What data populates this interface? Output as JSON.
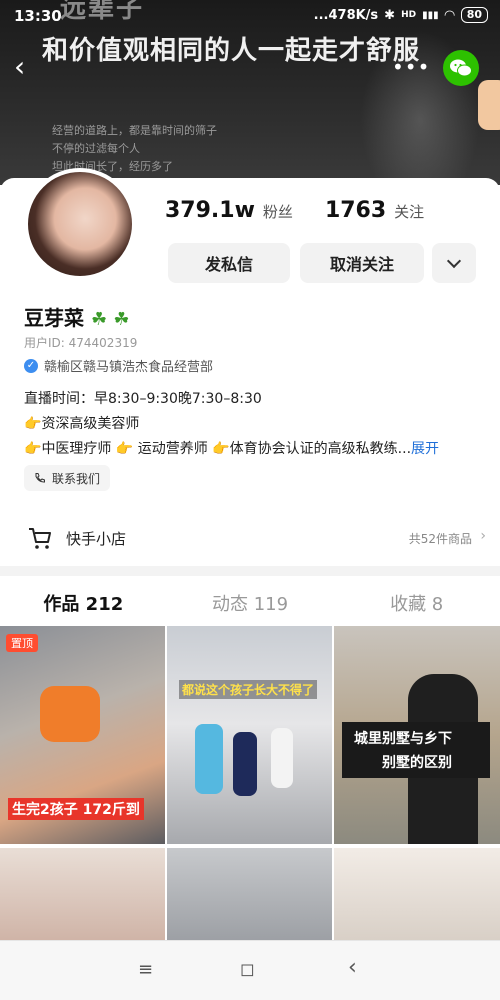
{
  "status_bar": {
    "time": "13:30",
    "network": "...478K/s",
    "bluetooth": "✱",
    "hd": "HD",
    "signal": "▮▮▮",
    "wifi": "◜◝",
    "battery": "80"
  },
  "banner": {
    "partial_top": "远辈子",
    "headline": "和价值观相同的人一起走才舒服",
    "lines": [
      "经营的道路上，都是靠时间的筛子",
      "不停的过滤每个人",
      "坦此时间长了，经历多了"
    ]
  },
  "profile": {
    "followers_count": "379.1w",
    "followers_label": "粉丝",
    "following_count": "1763",
    "following_label": "关注",
    "message_button": "发私信",
    "unfollow_button": "取消关注",
    "name": "豆芽菜",
    "clovers": "☘ ☘",
    "user_id": "用户ID: 474402319",
    "verification": "赣榆区赣马镇浩杰食品经营部",
    "bio": {
      "live_time": "直播时间：早8:30–9:30晚7:30–8:30",
      "line2_icon": "👉",
      "line2": "资深高级美容师",
      "line3_part1": "中医理疗师",
      "line3_part2": "运动营养师",
      "line3_part3": "体育协会认证的高级私教练...",
      "expand": "展开"
    },
    "contact_button": "联系我们"
  },
  "shop": {
    "label": "快手小店",
    "count": "共52件商品"
  },
  "tabs": [
    {
      "label": "作品 212"
    },
    {
      "label": "动态 119"
    },
    {
      "label": "收藏 8"
    }
  ],
  "posts": [
    {
      "pin": "置顶",
      "caption": "生完2孩子 172斤到"
    },
    {
      "caption": "都说这个孩子长大不得了"
    },
    {
      "caption_line1": "城里别墅与乡下",
      "caption_line2": "别墅的区别"
    }
  ],
  "colors": {
    "accent_blue": "#1f6fd8",
    "pin_red": "#ff4d30",
    "wechat_green": "#2dc100"
  },
  "icons": {
    "back": "‹",
    "more": "•••",
    "nav_menu": "≡",
    "nav_home": "◻",
    "nav_back": "‹"
  }
}
